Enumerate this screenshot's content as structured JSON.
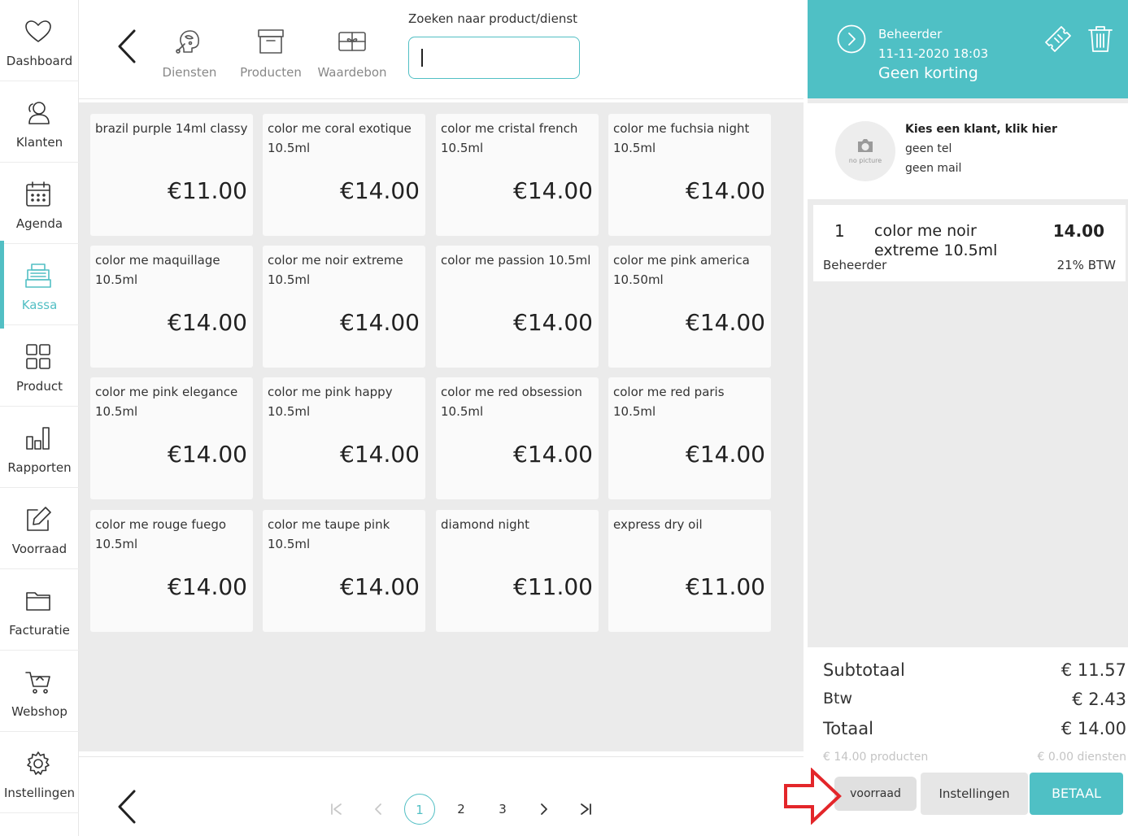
{
  "sidebar": {
    "items": [
      {
        "label": "Dashboard",
        "icon": "heart-icon"
      },
      {
        "label": "Klanten",
        "icon": "users-icon"
      },
      {
        "label": "Agenda",
        "icon": "calendar-icon"
      },
      {
        "label": "Kassa",
        "icon": "cash-register-icon",
        "active": true
      },
      {
        "label": "Product",
        "icon": "grid-icon"
      },
      {
        "label": "Rapporten",
        "icon": "bar-chart-icon"
      },
      {
        "label": "Voorraad",
        "icon": "edit-icon"
      },
      {
        "label": "Facturatie",
        "icon": "folder-icon"
      },
      {
        "label": "Webshop",
        "icon": "cart-icon"
      },
      {
        "label": "Instellingen",
        "icon": "gear-icon"
      }
    ]
  },
  "toolbar": {
    "categories": [
      {
        "label": "Diensten",
        "icon": "hairdresser-icon"
      },
      {
        "label": "Producten",
        "icon": "box-icon"
      },
      {
        "label": "Waardebon",
        "icon": "gift-card-icon"
      }
    ],
    "search_label": "Zoeken naar product/dienst",
    "search_value": ""
  },
  "products": [
    {
      "name": "brazil purple 14ml classy",
      "price": "€11.00"
    },
    {
      "name": "color me coral exotique 10.5ml",
      "price": "€14.00"
    },
    {
      "name": "color me cristal french 10.5ml",
      "price": "€14.00"
    },
    {
      "name": "color me fuchsia night 10.5ml",
      "price": "€14.00"
    },
    {
      "name": "color me maquillage 10.5ml",
      "price": "€14.00"
    },
    {
      "name": "color me noir extreme 10.5ml",
      "price": "€14.00"
    },
    {
      "name": "color me passion 10.5ml",
      "price": "€14.00"
    },
    {
      "name": "color me pink america 10.50ml",
      "price": "€14.00"
    },
    {
      "name": "color me pink elegance 10.5ml",
      "price": "€14.00"
    },
    {
      "name": "color me pink happy 10.5ml",
      "price": "€14.00"
    },
    {
      "name": "color me red obsession 10.5ml",
      "price": "€14.00"
    },
    {
      "name": "color me red paris 10.5ml",
      "price": "€14.00"
    },
    {
      "name": "color me rouge fuego 10.5ml",
      "price": "€14.00"
    },
    {
      "name": "color me taupe pink 10.5ml",
      "price": "€14.00"
    },
    {
      "name": "diamond night",
      "price": "€11.00"
    },
    {
      "name": "express dry oil",
      "price": "€11.00"
    }
  ],
  "pagination": {
    "pages": [
      "1",
      "2",
      "3"
    ],
    "current": "1"
  },
  "header": {
    "user": "Beheerder",
    "datetime": "11-11-2020 18:03",
    "discount": "Geen korting"
  },
  "client": {
    "title": "Kies een klant, klik hier",
    "tel": "geen tel",
    "mail": "geen mail",
    "avatar_text": "no picture"
  },
  "cart": {
    "lines": [
      {
        "qty": "1",
        "name": "color me noir extreme 10.5ml",
        "price": "14.00",
        "user": "Beheerder",
        "vat": "21% BTW"
      }
    ]
  },
  "totals": {
    "subtotal_label": "Subtotaal",
    "subtotal": "€ 11.57",
    "vat_label": "Btw",
    "vat": "€ 2.43",
    "total_label": "Totaal",
    "total": "€ 14.00",
    "products_sum": "€ 14.00 producten",
    "services_sum": "€ 0.00 diensten"
  },
  "buttons": {
    "stock": "voorraad",
    "settings": "Instellingen",
    "pay": "BETAAL"
  },
  "colors": {
    "accent": "#4fc0c5",
    "annotation_arrow": "#e3262a"
  }
}
